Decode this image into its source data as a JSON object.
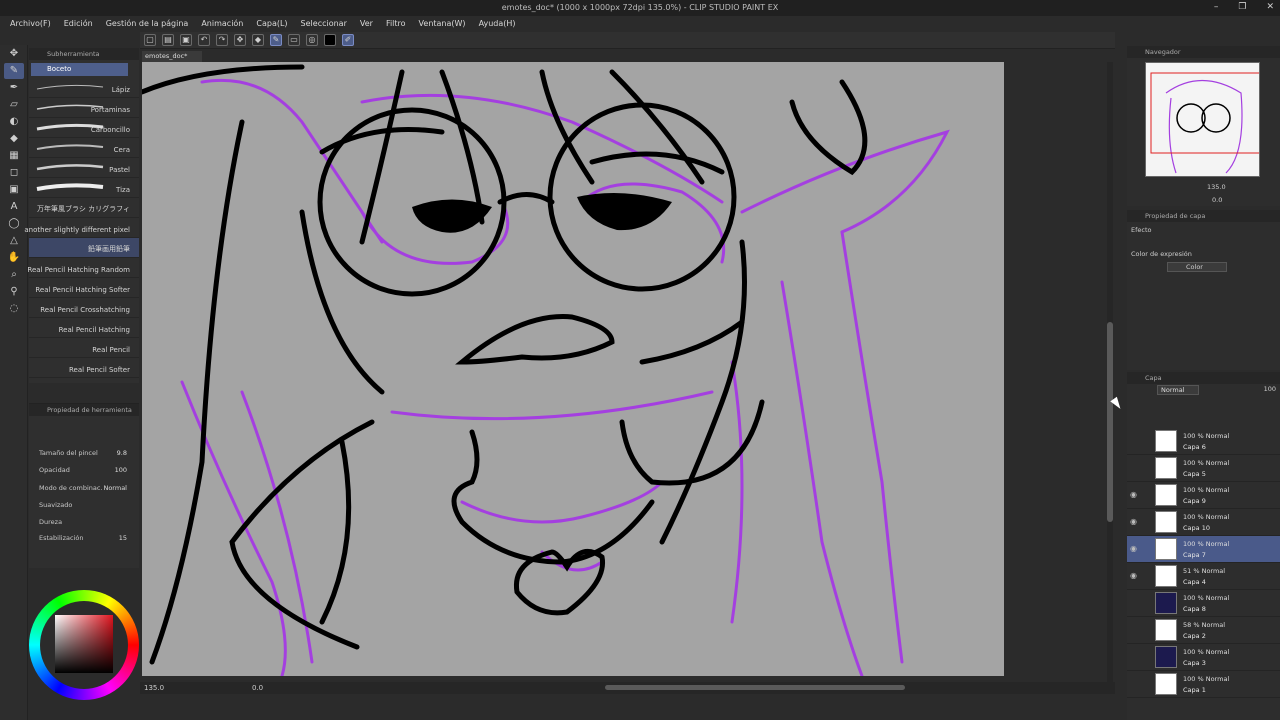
{
  "window": {
    "title": "emotes_doc* (1000 x 1000px 72dpi 135.0%) - CLIP STUDIO PAINT EX",
    "controls": [
      "–",
      "❐",
      "✕"
    ]
  },
  "menu": [
    "Archivo(F)",
    "Edición",
    "Gestión de la página",
    "Animación",
    "Capa(L)",
    "Seleccionar",
    "Ver",
    "Filtro",
    "Ventana(W)",
    "Ayuda(H)"
  ],
  "subtool": {
    "panel_title": "Subherramienta",
    "group": "Boceto",
    "brushes": [
      {
        "label": "Lápiz"
      },
      {
        "label": "Portaminas"
      },
      {
        "label": "Carboncillo"
      },
      {
        "label": "Cera"
      },
      {
        "label": "Pastel"
      },
      {
        "label": "Tiza"
      },
      {
        "label": "万年筆風ブラシ カリグラフィ"
      },
      {
        "label": "another slightly different pixel"
      },
      {
        "label": "鉛筆画用鉛筆"
      },
      {
        "label": "Real Pencil Hatching Random"
      },
      {
        "label": "Real Pencil Hatching Softer"
      },
      {
        "label": "Real Pencil Crosshatching"
      },
      {
        "label": "Real Pencil Hatching"
      },
      {
        "label": "Real Pencil"
      },
      {
        "label": "Real Pencil Softer"
      }
    ]
  },
  "tool_property": {
    "title": "Propiedad de herramienta",
    "brush_size_label": "Tamaño del pincel",
    "brush_size_value": "9.8",
    "opacity_label": "Opacidad",
    "opacity_value": "100",
    "blend_label": "Modo de combinac.",
    "blend_value": "Normal",
    "smoothing_label": "Suavizado",
    "hardness_label": "Dureza",
    "stabilization_label": "Estabilización",
    "stabilization_value": "15"
  },
  "document": {
    "tab": "emotes_doc*",
    "zoom": "135.0",
    "angle": "0.0"
  },
  "navigator": {
    "title": "Navegador",
    "zoom": "135.0",
    "angle": "0.0"
  },
  "layer_property": {
    "title": "Propiedad de capa",
    "effect_label": "Efecto",
    "expression_label": "Color de expresión",
    "expression_value": "Color"
  },
  "layers": {
    "title": "Capa",
    "blend_mode": "Normal",
    "opacity": "100",
    "items": [
      {
        "blend": "100 % Normal",
        "name": "Capa 6"
      },
      {
        "blend": "100 % Normal",
        "name": "Capa 5"
      },
      {
        "blend": "100 % Normal",
        "name": "Capa 9"
      },
      {
        "blend": "100 % Normal",
        "name": "Capa 10"
      },
      {
        "blend": "100 % Normal",
        "name": "Capa 7"
      },
      {
        "blend": "51 % Normal",
        "name": "Capa 4"
      },
      {
        "blend": "100 % Normal",
        "name": "Capa 8"
      },
      {
        "blend": "58 % Normal",
        "name": "Capa 2"
      },
      {
        "blend": "100 % Normal",
        "name": "Capa 3"
      },
      {
        "blend": "100 % Normal",
        "name": "Capa 1"
      }
    ]
  },
  "colors": {
    "accent": "#4a5a8a",
    "sketch_purple": "#a43fe0",
    "ink": "#000000",
    "paper": "#a4a4a4"
  }
}
